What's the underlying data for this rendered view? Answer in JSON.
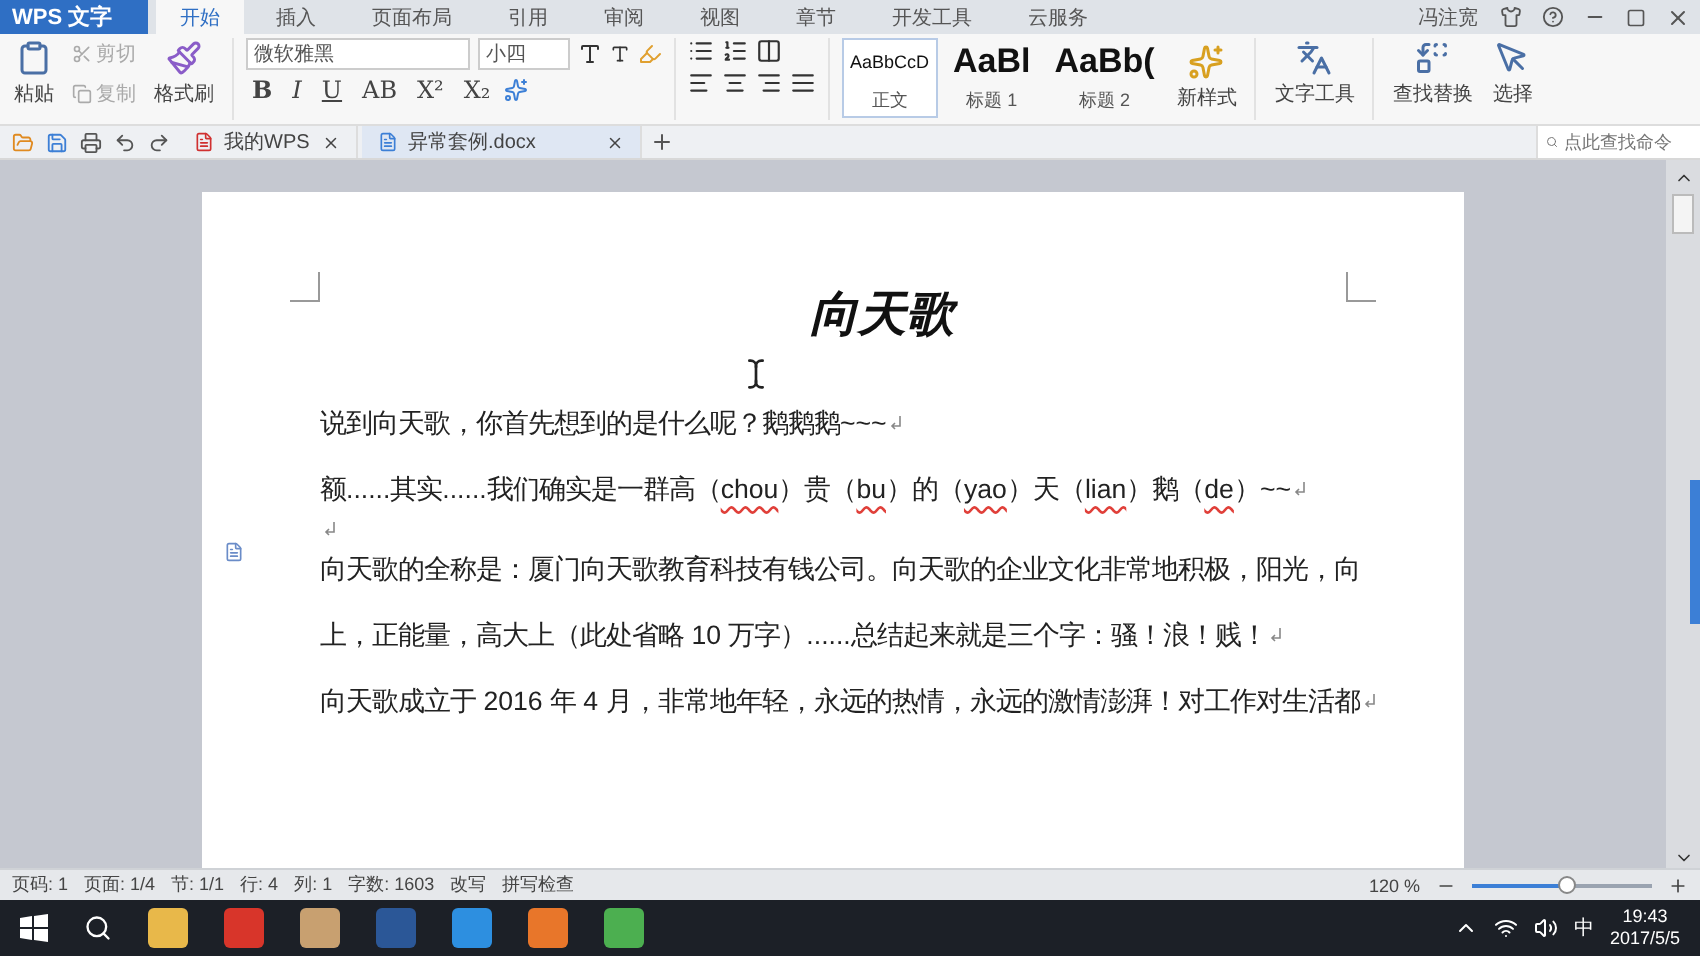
{
  "app_menu": {
    "label": "WPS 文字"
  },
  "menu_tabs": [
    {
      "label": "开始",
      "selected": true
    },
    {
      "label": "插入",
      "selected": false
    },
    {
      "label": "页面布局",
      "selected": false
    },
    {
      "label": "引用",
      "selected": false
    },
    {
      "label": "审阅",
      "selected": false
    },
    {
      "label": "视图",
      "selected": false
    },
    {
      "label": "章节",
      "selected": false
    },
    {
      "label": "开发工具",
      "selected": false
    },
    {
      "label": "云服务",
      "selected": false
    }
  ],
  "user": {
    "name": "冯注宽"
  },
  "ribbon": {
    "paste": "粘贴",
    "cut": "剪切",
    "copy": "复制",
    "format_painter": "格式刷",
    "font_family": "微软雅黑",
    "font_size": "小四",
    "format_buttons": [
      "B",
      "I",
      "U",
      "AB",
      "X²",
      "X₂"
    ],
    "styles": [
      {
        "preview": "AaBbCcD",
        "label": "正文",
        "selected": true
      },
      {
        "preview": "AaBl",
        "label": "标题 1",
        "selected": false
      },
      {
        "preview": "AaBb(",
        "label": "标题 2",
        "selected": false
      }
    ],
    "new_style": "新样式",
    "text_tools": "文字工具",
    "find_replace": "查找替换",
    "select": "选择"
  },
  "doc_tabs": [
    {
      "label": "我的WPS",
      "selected": false
    },
    {
      "label": "异常套例.docx",
      "selected": true
    }
  ],
  "command_search": {
    "placeholder": "点此查找命令"
  },
  "document": {
    "title": "向天歌",
    "paragraphs": [
      {
        "kind": "text",
        "lines": [
          [
            {
              "text": "说到向天歌，你首先想到的是什么呢？鹅鹅鹅~~~",
              "misspelled": false
            }
          ]
        ]
      },
      {
        "kind": "text",
        "lines": [
          [
            {
              "text": "额......其实......我们确实是一群高（",
              "misspelled": false
            },
            {
              "text": "chou",
              "misspelled": true
            },
            {
              "text": "）贵（",
              "misspelled": false
            },
            {
              "text": "bu",
              "misspelled": true
            },
            {
              "text": "）的（",
              "misspelled": false
            },
            {
              "text": "yao",
              "misspelled": true
            },
            {
              "text": "）天（",
              "misspelled": false
            },
            {
              "text": "lian",
              "misspelled": true
            },
            {
              "text": "）鹅（",
              "misspelled": false
            },
            {
              "text": "de",
              "misspelled": true
            },
            {
              "text": "）~~",
              "misspelled": false
            }
          ]
        ]
      },
      {
        "kind": "empty"
      },
      {
        "kind": "text",
        "lines": [
          [
            {
              "text": "向天歌的全称是：厦门向天歌教育科技有钱公司。向天歌的企业文化非常地积极，阳光，向",
              "misspelled": false
            }
          ],
          [
            {
              "text": "上，正能量，高大上（此处省略 10 万字）......总结起来就是三个字：骚！浪！贱！",
              "misspelled": false
            }
          ]
        ]
      },
      {
        "kind": "text",
        "lines": [
          [
            {
              "text": "向天歌成立于 2016 年 4 月，非常地年轻，永远的热情，永远的激情澎湃！对工作对生活都",
              "misspelled": false
            }
          ]
        ]
      }
    ]
  },
  "status_bar": {
    "items": [
      "页码: 1",
      "页面: 1/4",
      "节: 1/1",
      "行: 4",
      "列: 1",
      "字数: 1603"
    ],
    "overtype": "改写",
    "spell_check": "拼写检查",
    "zoom": "120 %",
    "zoom_slider": {
      "level": 0.52
    }
  },
  "taskbar": {
    "ime": "中",
    "time": "19:43",
    "date": "2017/5/5"
  }
}
